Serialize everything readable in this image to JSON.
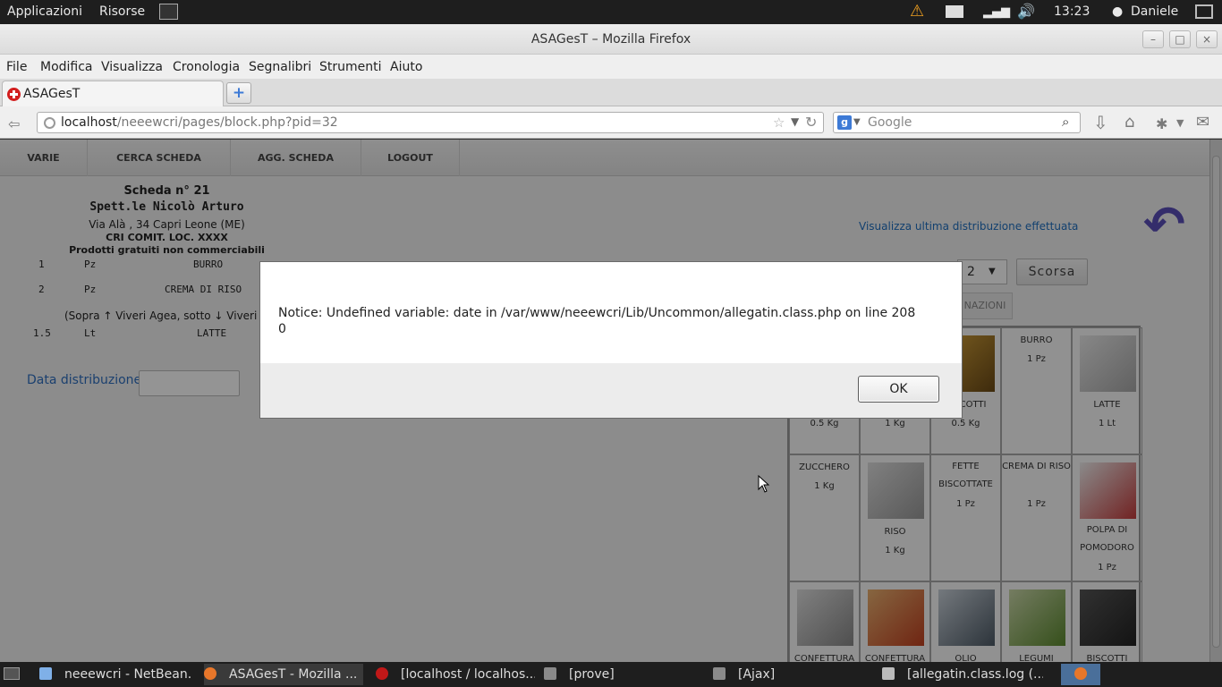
{
  "top_panel": {
    "applications": "Applicazioni",
    "places": "Risorse",
    "clock": "13:23",
    "user": "Daniele"
  },
  "window": {
    "title": "ASAGesT – Mozilla Firefox"
  },
  "menubar": [
    "File",
    "Modifica",
    "Visualizza",
    "Cronologia",
    "Segnalibri",
    "Strumenti",
    "Aiuto"
  ],
  "tab": {
    "label": "ASAGesT",
    "new_tab": "+"
  },
  "url": {
    "host": "localhost",
    "path": "/neeewcri/pages/block.php?pid=32"
  },
  "search": {
    "placeholder": "Google"
  },
  "app_nav": [
    "VARIE",
    "CERCA SCHEDA",
    "AGG. SCHEDA",
    "LOGOUT"
  ],
  "scheda": {
    "number": "Scheda n° 21",
    "name": "Spett.le Nicolò Arturo",
    "address": "Via Alà , 34 Capri Leone (ME)",
    "org": "CRI COMIT. LOC. XXXX",
    "note": "Prodotti gratuiti non commerciabili",
    "rows": [
      {
        "qty": "1",
        "unit": "Pz",
        "item": "BURRO"
      },
      {
        "qty": "2",
        "unit": "Pz",
        "item": "CREMA DI RISO"
      }
    ],
    "legend": "(Sopra ↑ Viveri Agea, sotto ↓ Viveri da do",
    "rows2": [
      {
        "qty": "1.5",
        "unit": "Lt",
        "item": "LATTE"
      }
    ],
    "date_label": "Data distribuzione:"
  },
  "right_panel": {
    "last_link": "Visualizza ultima distribuzione effettuata",
    "select_value": "2",
    "scorsa_button": "Scorsa",
    "nazioni_button": "NAZIONI"
  },
  "products": [
    {
      "name": "",
      "qty": "0.5 Kg"
    },
    {
      "name": "",
      "qty": "1 Kg"
    },
    {
      "name": "BISCOTTI",
      "qty": "0.5 Kg"
    },
    {
      "name": "BURRO",
      "qty": "1 Pz"
    },
    {
      "name": "LATTE",
      "qty": "1 Lt"
    },
    {
      "name": "ZUCCHERO",
      "qty": "1 Kg"
    },
    {
      "name": "RISO",
      "qty": "1 Kg"
    },
    {
      "name": "FETTE BISCOTTATE",
      "qty": "1 Pz"
    },
    {
      "name": "CREMA DI RISO",
      "qty": "1 Pz"
    },
    {
      "name": "POLPA DI POMODORO",
      "qty": "1 Pz"
    },
    {
      "name": "CONFETTURA",
      "qty": ""
    },
    {
      "name": "CONFETTURA",
      "qty": ""
    },
    {
      "name": "OLIO",
      "qty": ""
    },
    {
      "name": "LEGUMI",
      "qty": ""
    },
    {
      "name": "BISCOTTI",
      "qty": ""
    }
  ],
  "dialog": {
    "message": "Notice: Undefined variable: date in /var/www/neeewcri/Lib/Uncommon/allegatin.class.php on line 208\n0",
    "ok_button": "OK"
  },
  "taskbar": [
    {
      "label": "neeewcri - NetBean...",
      "icon": "netbeans-icon"
    },
    {
      "label": "ASAGesT - Mozilla ...",
      "icon": "firefox-icon"
    },
    {
      "label": "[localhost / localhos...",
      "icon": "opera-icon"
    },
    {
      "label": "[prove]",
      "icon": "folder-icon"
    },
    {
      "label": "[Ajax]",
      "icon": "folder-icon"
    },
    {
      "label": "[allegatin.class.log (...",
      "icon": "text-editor-icon"
    }
  ],
  "colors": {
    "accent_blue": "#2f6fbf",
    "link_blue": "#1f6fbf",
    "back_arrow": "#5a4fb8",
    "alert_red": "#d21d1d"
  }
}
